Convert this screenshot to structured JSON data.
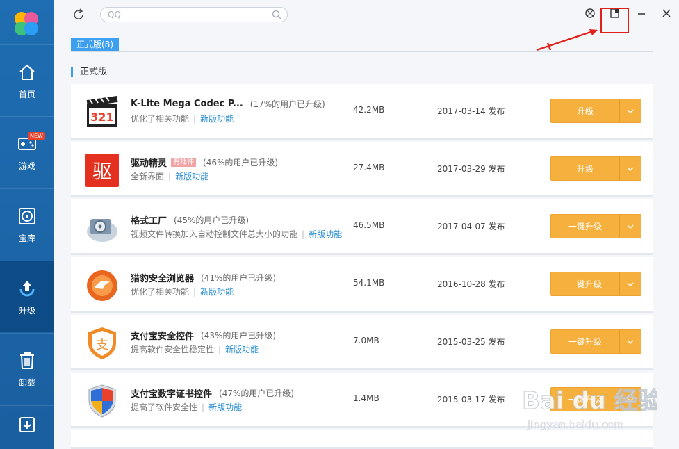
{
  "sidebar": {
    "items": [
      {
        "label": "首页",
        "icon": "home-icon"
      },
      {
        "label": "游戏",
        "icon": "gamepad-icon",
        "badge": "NEW"
      },
      {
        "label": "宝库",
        "icon": "disc-icon"
      },
      {
        "label": "升级",
        "icon": "upgrade-icon",
        "active": true
      },
      {
        "label": "卸载",
        "icon": "trash-icon"
      },
      {
        "label": "",
        "icon": "download-icon"
      }
    ]
  },
  "topbar": {
    "search_placeholder": "QQ"
  },
  "tab": {
    "label": "正式版(8)"
  },
  "section": {
    "title": "正式版"
  },
  "rows": [
    {
      "name": "K-Lite Mega Codec P...",
      "pct": "(17%的用户已升级)",
      "plugin": "",
      "desc": "优化了相关功能",
      "feature": "新版功能",
      "size": "42.2MB",
      "date": "2017-03-14 发布",
      "button": "升级"
    },
    {
      "name": "驱动精灵",
      "pct": "(46%的用户已升级)",
      "plugin": "有插件",
      "desc": "全新界面",
      "feature": "新版功能",
      "size": "27.4MB",
      "date": "2017-03-29 发布",
      "button": "升级"
    },
    {
      "name": "格式工厂",
      "pct": "(45%的用户已升级)",
      "plugin": "",
      "desc": "视频文件转换加入自动控制文件总大小的功能",
      "feature": "新版功能",
      "size": "46.5MB",
      "date": "2017-04-07 发布",
      "button": "一键升级"
    },
    {
      "name": "猎豹安全浏览器",
      "pct": "(41%的用户已升级)",
      "plugin": "",
      "desc": "优化了相关功能",
      "feature": "新版功能",
      "size": "54.1MB",
      "date": "2016-10-28 发布",
      "button": "一键升级"
    },
    {
      "name": "支付宝安全控件",
      "pct": "(43%的用户已升级)",
      "plugin": "",
      "desc": "提高软件安全性稳定性",
      "feature": "新版功能",
      "size": "7.0MB",
      "date": "2015-03-25 发布",
      "button": "一键升级"
    },
    {
      "name": "支付宝数字证书控件",
      "pct": "(47%的用户已升级)",
      "plugin": "",
      "desc": "提高了软件安全性",
      "feature": "新版功能",
      "size": "1.4MB",
      "date": "2015-03-17 发布",
      "button": "一键升级"
    }
  ],
  "watermark": {
    "brand": "Bai du 经验",
    "url": "jingyan.baidu.com"
  },
  "colors": {
    "sidebar": "#1f6db2",
    "active": "#0d4c86",
    "accent": "#3c9ff0",
    "button": "#f5b03e",
    "highlight": "#e0201b"
  }
}
